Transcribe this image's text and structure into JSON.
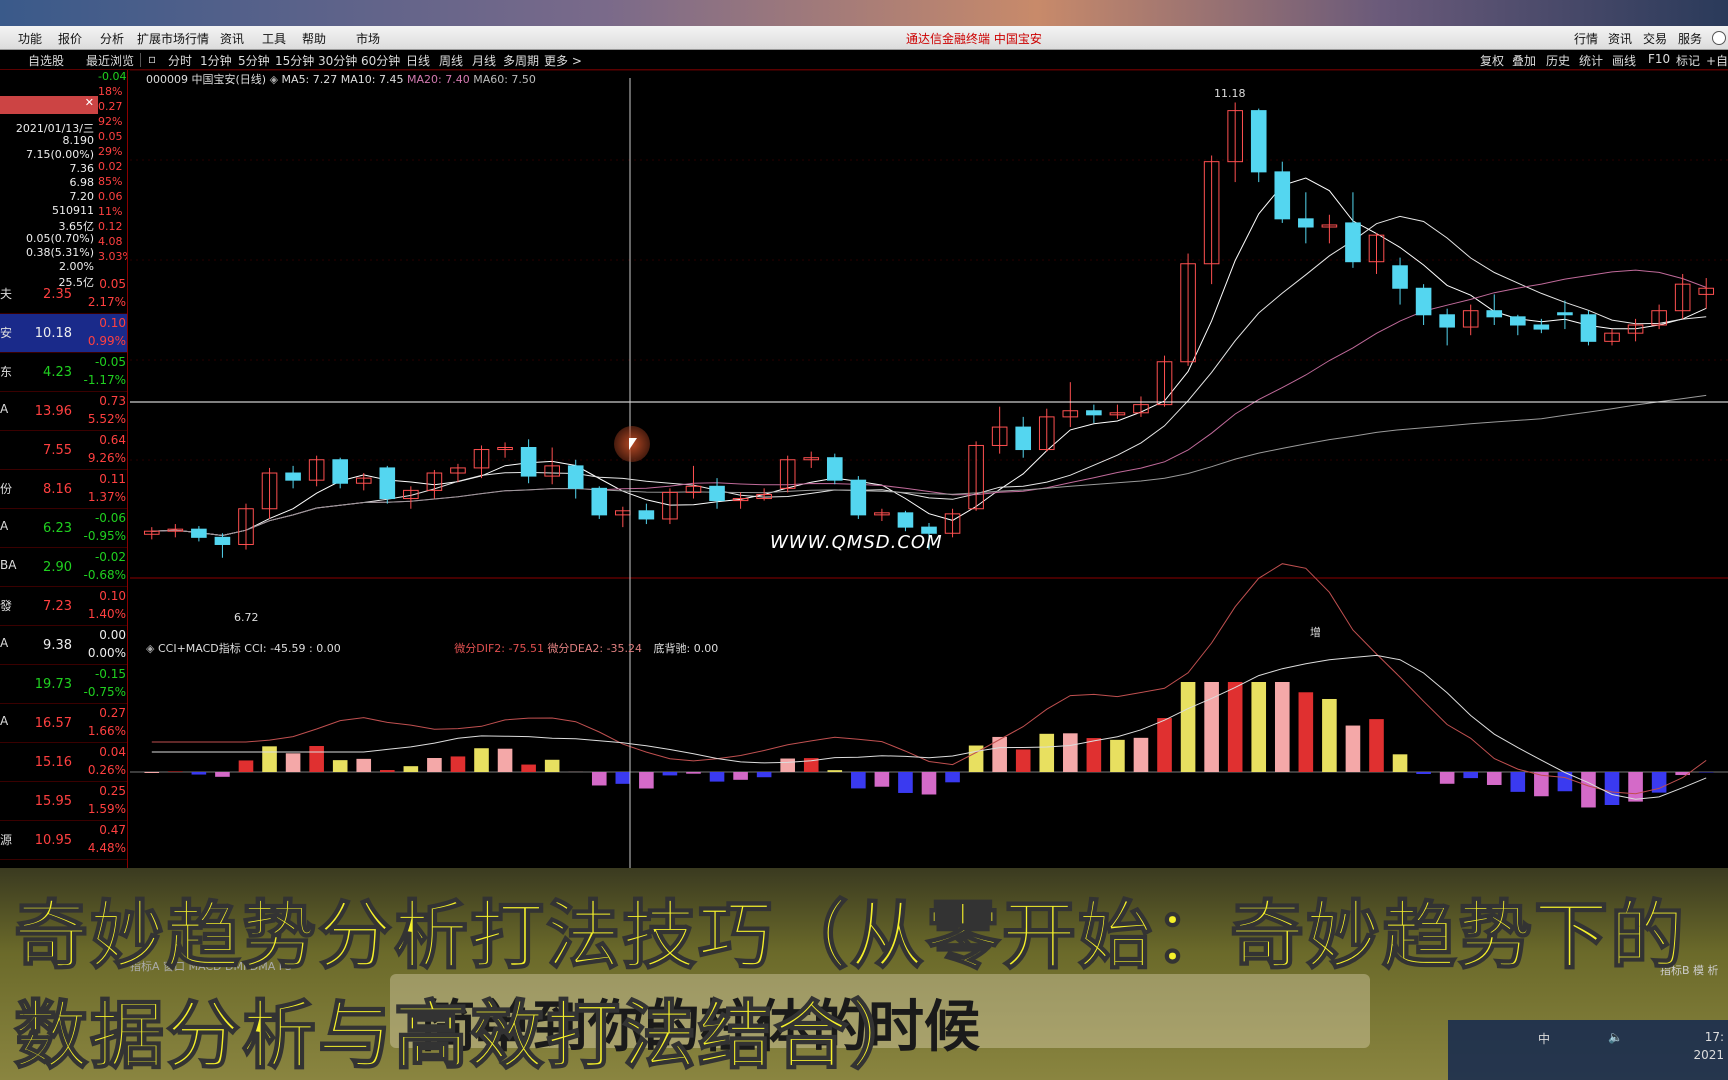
{
  "menu": {
    "left": [
      "功能",
      "报价",
      "分析",
      "扩展市场行情",
      "资讯",
      "工具",
      "帮助",
      "市场"
    ],
    "app_title": "通达信金融终端 中国宝安",
    "right": [
      "行情",
      "资讯",
      "交易",
      "服务"
    ]
  },
  "toolbar": {
    "left_tabs": [
      "自选股",
      "最近浏览"
    ],
    "periods": [
      "分时",
      "1分钟",
      "5分钟",
      "15分钟",
      "30分钟",
      "60分钟",
      "日线",
      "周线",
      "月线",
      "多周期",
      "更多 >"
    ],
    "right_tools": [
      "复权",
      "叠加",
      "历史",
      "统计",
      "画线",
      "F10",
      "标记",
      "+自"
    ]
  },
  "quote_card": {
    "date": "2021/01/13/三",
    "values": [
      "8.190",
      "7.15(0.00%)",
      "7.36",
      "6.98",
      "7.20",
      "510911",
      "3.65亿",
      "0.05(0.70%)",
      "0.38(5.31%)",
      "2.00%",
      "25.5亿"
    ]
  },
  "quote_side_values": [
    "-0.04",
    "18%",
    "0.27",
    "92%",
    "0.05",
    "29%",
    "0.02",
    "85%",
    "0.06",
    "11%",
    "0.12",
    "4.08",
    "3.03%"
  ],
  "watchlist": [
    {
      "name": "夫",
      "price": "2.35",
      "chg": "0.05",
      "pct": "2.17%",
      "dir": "up"
    },
    {
      "name": "安",
      "price": "10.18",
      "chg": "0.10",
      "pct": "0.99%",
      "dir": "up",
      "selected": true
    },
    {
      "name": "东",
      "price": "4.23",
      "chg": "-0.05",
      "pct": "-1.17%",
      "dir": "down"
    },
    {
      "name": "A",
      "price": "13.96",
      "chg": "0.73",
      "pct": "5.52%",
      "dir": "up"
    },
    {
      "name": "",
      "price": "7.55",
      "chg": "0.64",
      "pct": "9.26%",
      "dir": "up"
    },
    {
      "name": "份",
      "price": "8.16",
      "chg": "0.11",
      "pct": "1.37%",
      "dir": "up"
    },
    {
      "name": "A",
      "price": "6.23",
      "chg": "-0.06",
      "pct": "-0.95%",
      "dir": "down"
    },
    {
      "name": "BA",
      "price": "2.90",
      "chg": "-0.02",
      "pct": "-0.68%",
      "dir": "down"
    },
    {
      "name": "發",
      "price": "7.23",
      "chg": "0.10",
      "pct": "1.40%",
      "dir": "up"
    },
    {
      "name": "A",
      "price": "9.38",
      "chg": "0.00",
      "pct": "0.00%",
      "dir": "flat"
    },
    {
      "name": "",
      "price": "19.73",
      "chg": "-0.15",
      "pct": "-0.75%",
      "dir": "down"
    },
    {
      "name": "A",
      "price": "16.57",
      "chg": "0.27",
      "pct": "1.66%",
      "dir": "up"
    },
    {
      "name": "",
      "price": "15.16",
      "chg": "0.04",
      "pct": "0.26%",
      "dir": "up"
    },
    {
      "name": "",
      "price": "15.95",
      "chg": "0.25",
      "pct": "1.59%",
      "dir": "up"
    },
    {
      "name": "源",
      "price": "10.95",
      "chg": "0.47",
      "pct": "4.48%",
      "dir": "up"
    }
  ],
  "main_chart": {
    "stock": "000009 中国宝安(日线)",
    "ma5": "MA5: 7.27",
    "ma10": "MA10: 7.45",
    "ma20": "MA20: 7.40",
    "ma60": "MA60: 7.50",
    "high_label": "11.18",
    "low_label": "6.72",
    "marker_label": "增"
  },
  "sub_chart": {
    "title": "CCI+MACD指标",
    "cci": "CCI: -45.59 : 0.00",
    "dif": "微分DIF2: -75.51",
    "dea": "微分DEA2: -35.24",
    "div": "底背驰: 0.00"
  },
  "watermark": "WWW.QMSD.COM",
  "bottom_tabs": [
    "指标A",
    "窗口",
    "MACD",
    "DMI",
    "DMA",
    "FS"
  ],
  "bottom_right_tabs": [
    "指标B",
    "模",
    "析"
  ],
  "overlay": {
    "title_line1": "奇妙趋势分析打法技巧（从零开始：奇妙趋势下的",
    "title_line2": "数据分析与高效打法结合）",
    "caption": "简单到你的柱体的时候"
  },
  "tray": {
    "time": "17:",
    "year": "2021",
    "ime": "中"
  },
  "chart_data": {
    "type": "candlestick",
    "title": "000009 中国宝安(日线)",
    "note": "Daily candles (approximate, read from chart)",
    "ohlc": [
      [
        6.95,
        7.02,
        6.9,
        6.98
      ],
      [
        6.98,
        7.05,
        6.92,
        7.0
      ],
      [
        7.0,
        7.03,
        6.88,
        6.92
      ],
      [
        6.92,
        6.96,
        6.72,
        6.85
      ],
      [
        6.85,
        7.25,
        6.8,
        7.2
      ],
      [
        7.2,
        7.6,
        7.1,
        7.55
      ],
      [
        7.55,
        7.62,
        7.4,
        7.48
      ],
      [
        7.48,
        7.72,
        7.42,
        7.68
      ],
      [
        7.68,
        7.7,
        7.4,
        7.45
      ],
      [
        7.45,
        7.55,
        7.38,
        7.5
      ],
      [
        7.6,
        7.62,
        7.25,
        7.3
      ],
      [
        7.3,
        7.42,
        7.2,
        7.38
      ],
      [
        7.38,
        7.58,
        7.3,
        7.55
      ],
      [
        7.55,
        7.64,
        7.46,
        7.6
      ],
      [
        7.6,
        7.82,
        7.5,
        7.78
      ],
      [
        7.78,
        7.85,
        7.7,
        7.8
      ],
      [
        7.8,
        7.88,
        7.45,
        7.52
      ],
      [
        7.52,
        7.8,
        7.44,
        7.62
      ],
      [
        7.62,
        7.68,
        7.3,
        7.4
      ],
      [
        7.4,
        7.42,
        7.1,
        7.14
      ],
      [
        7.14,
        7.22,
        7.02,
        7.18
      ],
      [
        7.18,
        7.25,
        7.05,
        7.1
      ],
      [
        7.1,
        7.4,
        7.05,
        7.36
      ],
      [
        7.36,
        7.62,
        7.3,
        7.42
      ],
      [
        7.42,
        7.5,
        7.2,
        7.28
      ],
      [
        7.28,
        7.36,
        7.2,
        7.3
      ],
      [
        7.3,
        7.4,
        7.28,
        7.34
      ],
      [
        7.4,
        7.72,
        7.36,
        7.68
      ],
      [
        7.68,
        7.76,
        7.6,
        7.7
      ],
      [
        7.7,
        7.74,
        7.44,
        7.48
      ],
      [
        7.48,
        7.52,
        7.1,
        7.14
      ],
      [
        7.14,
        7.2,
        7.08,
        7.16
      ],
      [
        7.16,
        7.18,
        6.98,
        7.02
      ],
      [
        7.02,
        7.06,
        6.8,
        6.96
      ],
      [
        6.96,
        7.2,
        6.92,
        7.15
      ],
      [
        7.2,
        7.86,
        7.18,
        7.82
      ],
      [
        7.82,
        8.2,
        7.74,
        8.0
      ],
      [
        8.0,
        8.1,
        7.7,
        7.78
      ],
      [
        7.78,
        8.18,
        7.76,
        8.1
      ],
      [
        8.1,
        8.44,
        8.0,
        8.16
      ],
      [
        8.16,
        8.22,
        8.04,
        8.12
      ],
      [
        8.12,
        8.22,
        8.08,
        8.14
      ],
      [
        8.14,
        8.3,
        8.1,
        8.22
      ],
      [
        8.22,
        8.7,
        8.2,
        8.64
      ],
      [
        8.64,
        9.7,
        8.6,
        9.6
      ],
      [
        9.6,
        10.66,
        9.4,
        10.6
      ],
      [
        10.6,
        11.18,
        10.4,
        11.1
      ],
      [
        11.1,
        11.12,
        10.4,
        10.5
      ],
      [
        10.5,
        10.6,
        10.0,
        10.04
      ],
      [
        10.04,
        10.3,
        9.8,
        9.96
      ],
      [
        9.96,
        10.08,
        9.8,
        9.98
      ],
      [
        10.0,
        10.3,
        9.56,
        9.62
      ],
      [
        9.62,
        9.9,
        9.5,
        9.88
      ],
      [
        9.58,
        9.66,
        9.2,
        9.36
      ],
      [
        9.36,
        9.4,
        9.0,
        9.1
      ],
      [
        9.1,
        9.16,
        8.8,
        8.98
      ],
      [
        8.98,
        9.2,
        8.9,
        9.14
      ],
      [
        9.14,
        9.3,
        9.0,
        9.08
      ],
      [
        9.08,
        9.1,
        8.9,
        9.0
      ],
      [
        9.0,
        9.06,
        8.92,
        8.96
      ],
      [
        9.12,
        9.24,
        8.96,
        9.1
      ],
      [
        9.1,
        9.14,
        8.8,
        8.84
      ],
      [
        8.84,
        8.96,
        8.8,
        8.92
      ],
      [
        8.92,
        9.06,
        8.84,
        9.0
      ],
      [
        9.0,
        9.2,
        8.96,
        9.14
      ],
      [
        9.14,
        9.5,
        9.06,
        9.4
      ],
      [
        9.3,
        9.46,
        9.16,
        9.36
      ]
    ],
    "y_range": [
      6.6,
      11.4
    ]
  }
}
